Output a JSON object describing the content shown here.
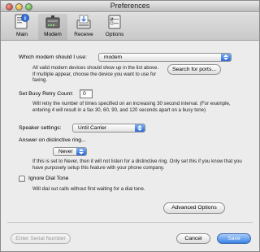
{
  "window": {
    "title": "Preferences"
  },
  "toolbar": {
    "items": [
      {
        "label": "Main",
        "icon": "main-icon"
      },
      {
        "label": "Modem",
        "icon": "modem-icon"
      },
      {
        "label": "Receive",
        "icon": "receive-icon"
      },
      {
        "label": "Options",
        "icon": "options-icon"
      }
    ]
  },
  "modem": {
    "label": "Which modem should I use:",
    "value": "modem",
    "help": "All valid modem devices should show up in the list above. If multiple appear, choose the device you want to use for faxing.",
    "search_button": "Search for ports..."
  },
  "busy": {
    "label": "Set Busy Retry Count:",
    "value": "0",
    "help": "Will retry the number of times specified on an increasing 30 second interval. (For example, entering 4 will result in a fax 30, 60, 90, and 120 seconds apart on a busy tone)"
  },
  "speaker": {
    "label": "Speaker settings:",
    "value": "Until Carrier"
  },
  "ring": {
    "label": "Answer on distinctive ring...",
    "value": "Never",
    "help": "If this is set to Never, then it will not listen for a distinctive ring. Only set this if you know that you have purposely setup this feature with your phone company."
  },
  "dial_tone": {
    "label": "Ignore Dial Tone",
    "help": "Will dial out calls without first waiting for a dial tone."
  },
  "advanced_button": "Advanced Options",
  "footer": {
    "serial_button": "Enter Serial Number",
    "cancel_button": "Cancel",
    "save_button": "Save"
  },
  "colors": {
    "accent": "#3a82e6",
    "window_bg": "#ececec"
  }
}
